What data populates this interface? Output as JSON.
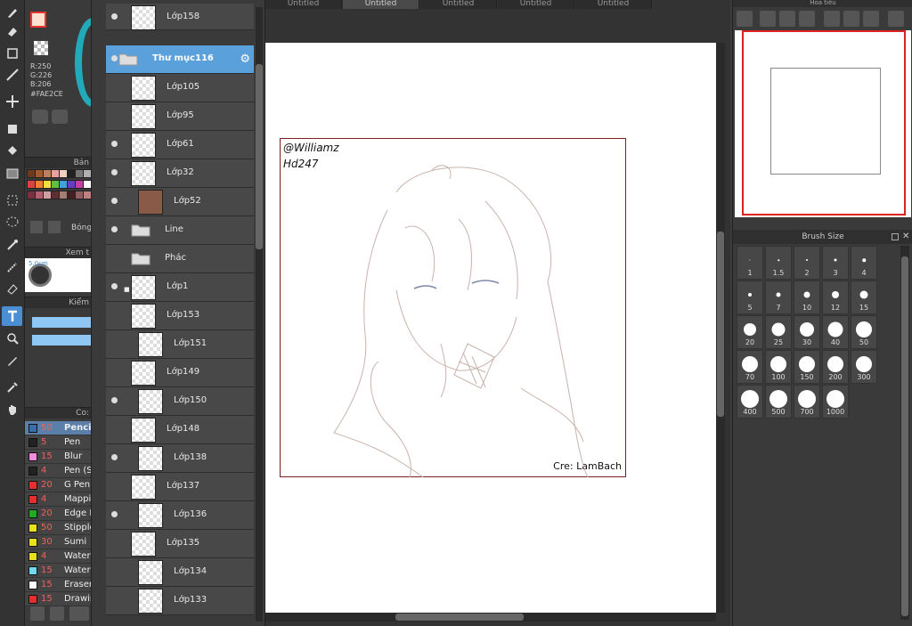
{
  "color": {
    "r": "R:250",
    "g": "G:226",
    "b": "B:206",
    "hex": "#FAE2CE",
    "main": "#FAE2CE"
  },
  "left": {
    "palette_label": "Bản",
    "palette_shadow_label": "Bóng",
    "preview_label": "Xem t",
    "preview_size": "5.0cm",
    "check_label": "Kiểm",
    "brushes_label": "Co:"
  },
  "brush_list": [
    {
      "num": "50",
      "name": "Pencil",
      "color": "#3a6ea8",
      "sel": true
    },
    {
      "num": "5",
      "name": "Pen",
      "color": "#222222"
    },
    {
      "num": "15",
      "name": "Blur",
      "color": "#f08ce0"
    },
    {
      "num": "4",
      "name": "Pen (S",
      "color": "#222222"
    },
    {
      "num": "20",
      "name": "G Pen",
      "color": "#e03030"
    },
    {
      "num": "4",
      "name": "Mappin",
      "color": "#e03030"
    },
    {
      "num": "20",
      "name": "Edge I",
      "color": "#22aa22"
    },
    {
      "num": "50",
      "name": "Stipple",
      "color": "#e8e020"
    },
    {
      "num": "30",
      "name": "Sumi",
      "color": "#e8e020"
    },
    {
      "num": "4",
      "name": "Water",
      "color": "#e8e020"
    },
    {
      "num": "15",
      "name": "Water",
      "color": "#70d8f0"
    },
    {
      "num": "15",
      "name": "Eraser",
      "color": "#ffffff"
    },
    {
      "num": "15",
      "name": "Drawin",
      "color": "#e03030"
    }
  ],
  "layers": [
    {
      "name": "Lớp158",
      "eye": true,
      "indent": 0,
      "type": "layer"
    },
    {
      "name": "Thư mục116",
      "eye": true,
      "indent": 0,
      "type": "folder",
      "sel": true
    },
    {
      "name": "Lớp105",
      "eye": false,
      "indent": 1,
      "type": "layer"
    },
    {
      "name": "Lớp95",
      "eye": false,
      "indent": 1,
      "type": "layer"
    },
    {
      "name": "Lớp61",
      "eye": true,
      "indent": 1,
      "type": "layer"
    },
    {
      "name": "Lớp32",
      "eye": true,
      "indent": 1,
      "type": "layer"
    },
    {
      "name": "Lớp52",
      "eye": true,
      "indent": 2,
      "type": "brown"
    },
    {
      "name": "Line",
      "eye": true,
      "indent": 1,
      "type": "folder"
    },
    {
      "name": "Phác",
      "eye": false,
      "indent": 1,
      "type": "folder"
    },
    {
      "name": "Lớp1",
      "eye": true,
      "indent": 1,
      "type": "layer",
      "lock": true
    },
    {
      "name": "Lớp153",
      "eye": false,
      "indent": 1,
      "type": "layer"
    },
    {
      "name": "Lớp151",
      "eye": false,
      "indent": 2,
      "type": "layer"
    },
    {
      "name": "Lớp149",
      "eye": false,
      "indent": 1,
      "type": "layer"
    },
    {
      "name": "Lớp150",
      "eye": true,
      "indent": 2,
      "type": "layer"
    },
    {
      "name": "Lớp148",
      "eye": false,
      "indent": 1,
      "type": "layer"
    },
    {
      "name": "Lớp138",
      "eye": true,
      "indent": 2,
      "type": "layer"
    },
    {
      "name": "Lớp137",
      "eye": false,
      "indent": 1,
      "type": "layer"
    },
    {
      "name": "Lớp136",
      "eye": true,
      "indent": 2,
      "type": "layer"
    },
    {
      "name": "Lớp135",
      "eye": false,
      "indent": 1,
      "type": "layer"
    },
    {
      "name": "Lớp134",
      "eye": false,
      "indent": 2,
      "type": "layer"
    },
    {
      "name": "Lớp133",
      "eye": false,
      "indent": 2,
      "type": "layer"
    }
  ],
  "tabs": [
    "Untitled",
    "Untitled",
    "Untitled",
    "Untitled",
    "Untitled"
  ],
  "canvas": {
    "signature": "@Williamz",
    "sub": "Hd247",
    "credit": "Cre: LamBach"
  },
  "navigator": {
    "title": "Hoa tiêu"
  },
  "brush_size": {
    "title": "Brush Size",
    "sizes": [
      "1",
      "1.5",
      "2",
      "3",
      "4",
      "5",
      "7",
      "10",
      "12",
      "15",
      "20",
      "25",
      "30",
      "40",
      "50",
      "70",
      "100",
      "150",
      "200",
      "300",
      "400",
      "500",
      "700",
      "1000"
    ]
  }
}
